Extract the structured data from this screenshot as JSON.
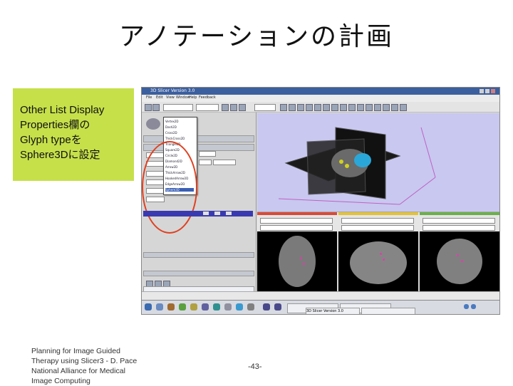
{
  "slide": {
    "title": "アノテーションの計画",
    "callout": "Other List Display\nProperties欄の\nGlyph typeを\nSphere3Dに設定",
    "footer": "Planning for Image Guided Therapy using Slicer3 - D. Pace National Alliance for Medical Image Computing",
    "page_number": "-43-"
  },
  "screenshot": {
    "window_title": "3D Slicer Version 3.0",
    "menu": [
      "File",
      "Edit",
      "View",
      "Window",
      "Help",
      "Feedback"
    ],
    "glyph_options": [
      "Vertex2D",
      "Dash2D",
      "Cross2D",
      "ThickCross2D",
      "Triangle2D",
      "Square2D",
      "Circle2D",
      "Diamond2D",
      "Arrow2D",
      "ThickArrow2D",
      "HookedArrow2D",
      "EdgeArrow2D",
      "Sphere3D"
    ],
    "selected_glyph": "Sphere3D",
    "taskbar_window": "3D Slicer Version 3.0",
    "colors": {
      "titlebar": "#3c5f9e",
      "callout": "#c6e04a",
      "highlight_ring": "#e04020",
      "annotation": "#e33cb0"
    }
  }
}
